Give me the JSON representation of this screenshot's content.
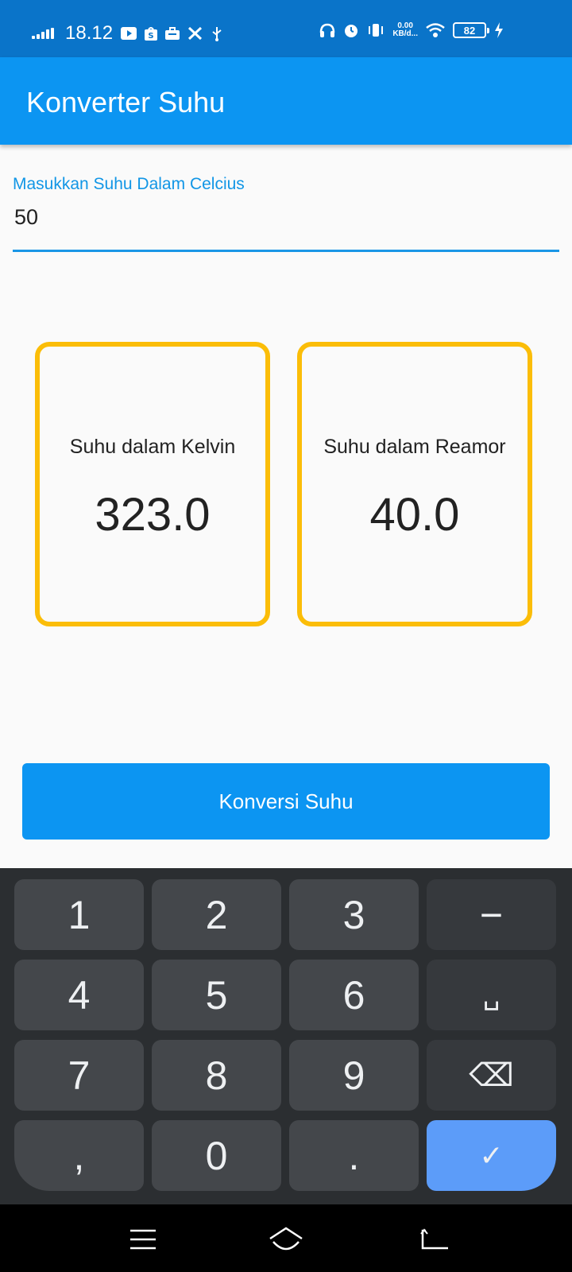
{
  "status_bar": {
    "time": "18.12",
    "net_speed_value": "0.00",
    "net_speed_unit": "KB/d...",
    "battery_level": "82",
    "icons": [
      "signal-icon",
      "youtube-icon",
      "shopee-icon",
      "briefcase-icon",
      "tools-icon",
      "usb-icon",
      "headphones-icon",
      "alarm-icon",
      "vibrate-icon",
      "wifi-icon",
      "battery-icon",
      "charging-icon"
    ]
  },
  "app_bar": {
    "title": "Konverter Suhu"
  },
  "input": {
    "label": "Masukkan Suhu Dalam Celcius",
    "value": "50"
  },
  "results": [
    {
      "label": "Suhu dalam Kelvin",
      "value": "323.0"
    },
    {
      "label": "Suhu dalam Reamor",
      "value": "40.0"
    }
  ],
  "convert_button": {
    "label": "Konversi Suhu"
  },
  "keyboard": {
    "keys": [
      "1",
      "2",
      "3",
      "−",
      "4",
      "5",
      "6",
      "␣",
      "7",
      "8",
      "9",
      "⌫",
      ",",
      "0",
      ".",
      "✓"
    ]
  },
  "nav_bar": {
    "icons": [
      "menu-icon",
      "home-icon",
      "back-icon"
    ]
  },
  "colors": {
    "primary": "#0c95f2",
    "status_bar": "#0a74c9",
    "card_border": "#fbbd08",
    "enter_key": "#5c9cf9"
  }
}
